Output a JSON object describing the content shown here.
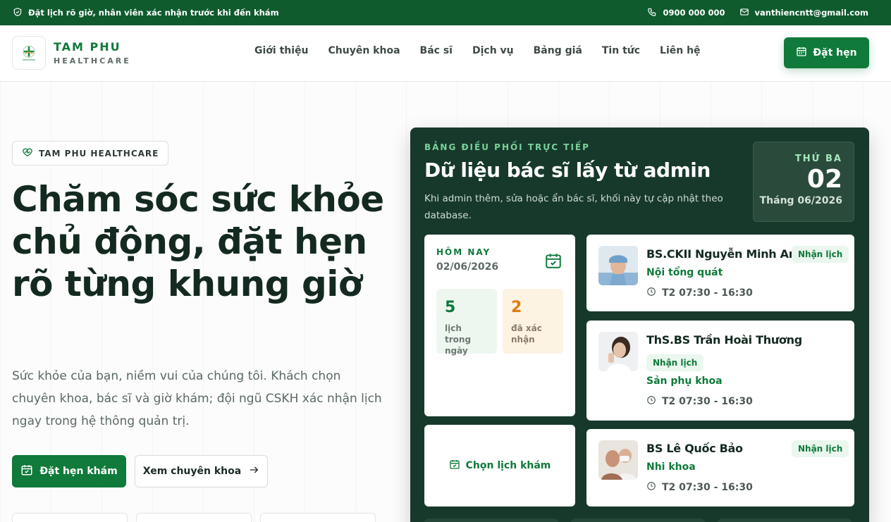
{
  "topbar": {
    "notice": "Đặt lịch rõ giờ, nhân viên xác nhận trước khi đến khám",
    "phone": "0900 000 000",
    "email": "vanthiencntt@gmail.com"
  },
  "header": {
    "brand_name": "TAM PHU",
    "brand_sub": "HEALTHCARE",
    "nav": [
      "Giới thiệu",
      "Chuyên khoa",
      "Bác sĩ",
      "Dịch vụ",
      "Bảng giá",
      "Tin tức",
      "Liên hệ"
    ],
    "book_label": "Đặt hẹn"
  },
  "hero": {
    "pill": "TAM PHU HEALTHCARE",
    "headline": "Chăm sóc sức khỏe chủ động, đặt hẹn rõ từng khung giờ",
    "lead": "Sức khỏe của bạn, niềm vui của chúng tôi. Khách chọn chuyên khoa, bác sĩ và giờ khám; đội ngũ CSKH xác nhận lịch ngay trong hệ thông quản trị.",
    "cta_primary": "Đặt hẹn khám",
    "cta_secondary": "Xem chuyên khoa"
  },
  "panel": {
    "kicker": "BẢNG ĐIỀU PHỐI TRỰC TIẾP",
    "title": "Dữ liệu bác sĩ lấy từ admin",
    "desc": "Khi admin thêm, sửa hoặc ẩn bác sĩ, khối này tự cập nhật theo database.",
    "date": {
      "dow": "THỨ BA",
      "day": "02",
      "month": "Tháng 06/2026"
    },
    "today": {
      "kicker": "HÔM NAY",
      "date": "02/06/2026",
      "stats": [
        {
          "value": "5",
          "label": "lịch trong ngày"
        },
        {
          "value": "2",
          "label": "đã xác nhận"
        }
      ]
    },
    "choose_label": "Chọn lịch khám",
    "doctors": [
      {
        "name": "BS.CKII Nguyễn Minh An",
        "specialty": "Nội tổng quát",
        "hours": "T2 07:30 - 16:30",
        "tag": "Nhận lịch"
      },
      {
        "name": "ThS.BS Trần Hoài Thương",
        "specialty": "Sản phụ khoa",
        "hours": "T2 07:30 - 16:30",
        "tag": "Nhận lịch"
      },
      {
        "name": "BS Lê Quốc Bảo",
        "specialty": "Nhi khoa",
        "hours": "T2 07:30 - 16:30",
        "tag": "Nhận lịch"
      }
    ]
  },
  "colors": {
    "brand": "#0f7a3a",
    "topbar": "#0f5b2e",
    "panel": "#17392b",
    "accent_amber": "#e07d06"
  }
}
